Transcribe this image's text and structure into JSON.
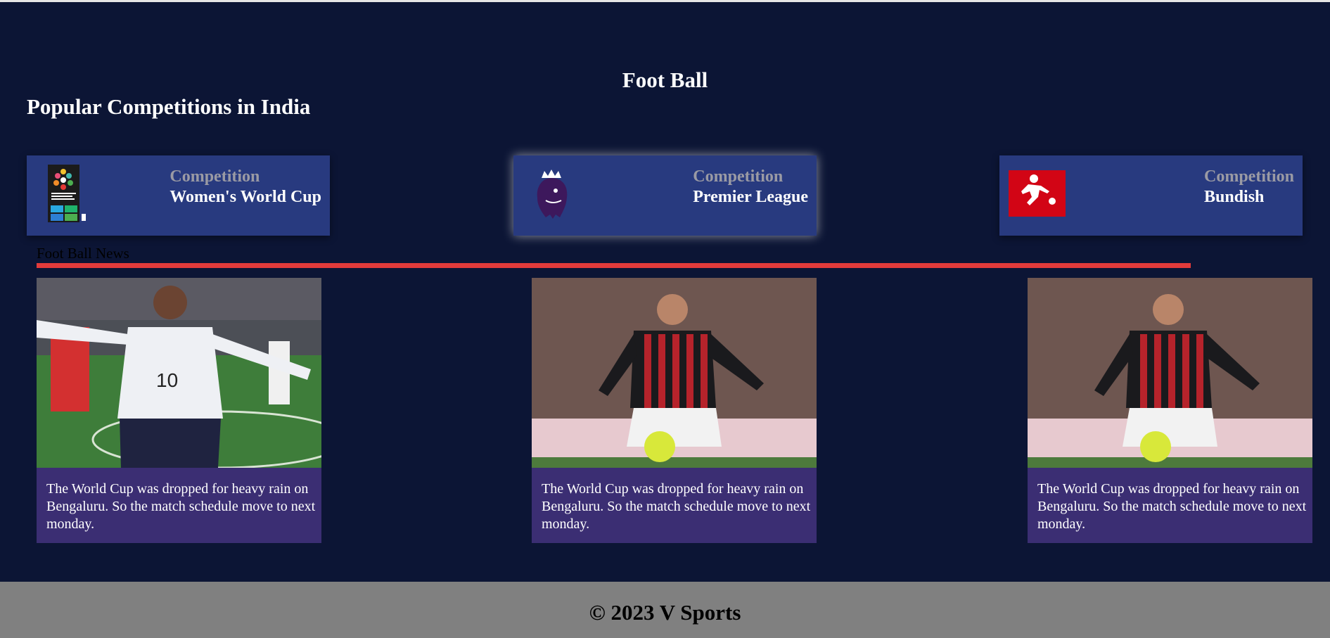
{
  "header": {
    "title": "Foot Ball"
  },
  "competitions_section": {
    "title": "Popular Competitions in India"
  },
  "competitions": [
    {
      "kicker": "Competition",
      "name": "Women's World Cup",
      "logo_icon": "fifa-womens-world-cup-2023-logo",
      "logo_lettering": "FIFA WOMEN'S WORLD CUP AU NZ 2023"
    },
    {
      "kicker": "Competition",
      "name": "Premier League",
      "logo_icon": "premier-league-lion-logo"
    },
    {
      "kicker": "Competition",
      "name": "Bundish",
      "logo_icon": "bundesliga-logo"
    }
  ],
  "news": {
    "label": "Foot Ball News",
    "accent_color": "#e23b3b",
    "cards": [
      {
        "image": "player-white-kit-celebrating-photo",
        "text": "The World Cup was dropped for heavy rain on Bengaluru. So the match schedule move to next monday."
      },
      {
        "image": "player-red-black-kit-ball-photo",
        "text": "The World Cup was dropped for heavy rain on Bengaluru. So the match schedule move to next monday."
      },
      {
        "image": "player-red-black-kit-ball-photo",
        "text": "The World Cup was dropped for heavy rain on Bengaluru. So the match schedule move to next monday."
      }
    ]
  },
  "footer": {
    "text": "© 2023 V Sports"
  },
  "colors": {
    "background": "#0c1535",
    "card": "#283a7f",
    "news_card": "#3b2e73",
    "footer": "#808080"
  }
}
